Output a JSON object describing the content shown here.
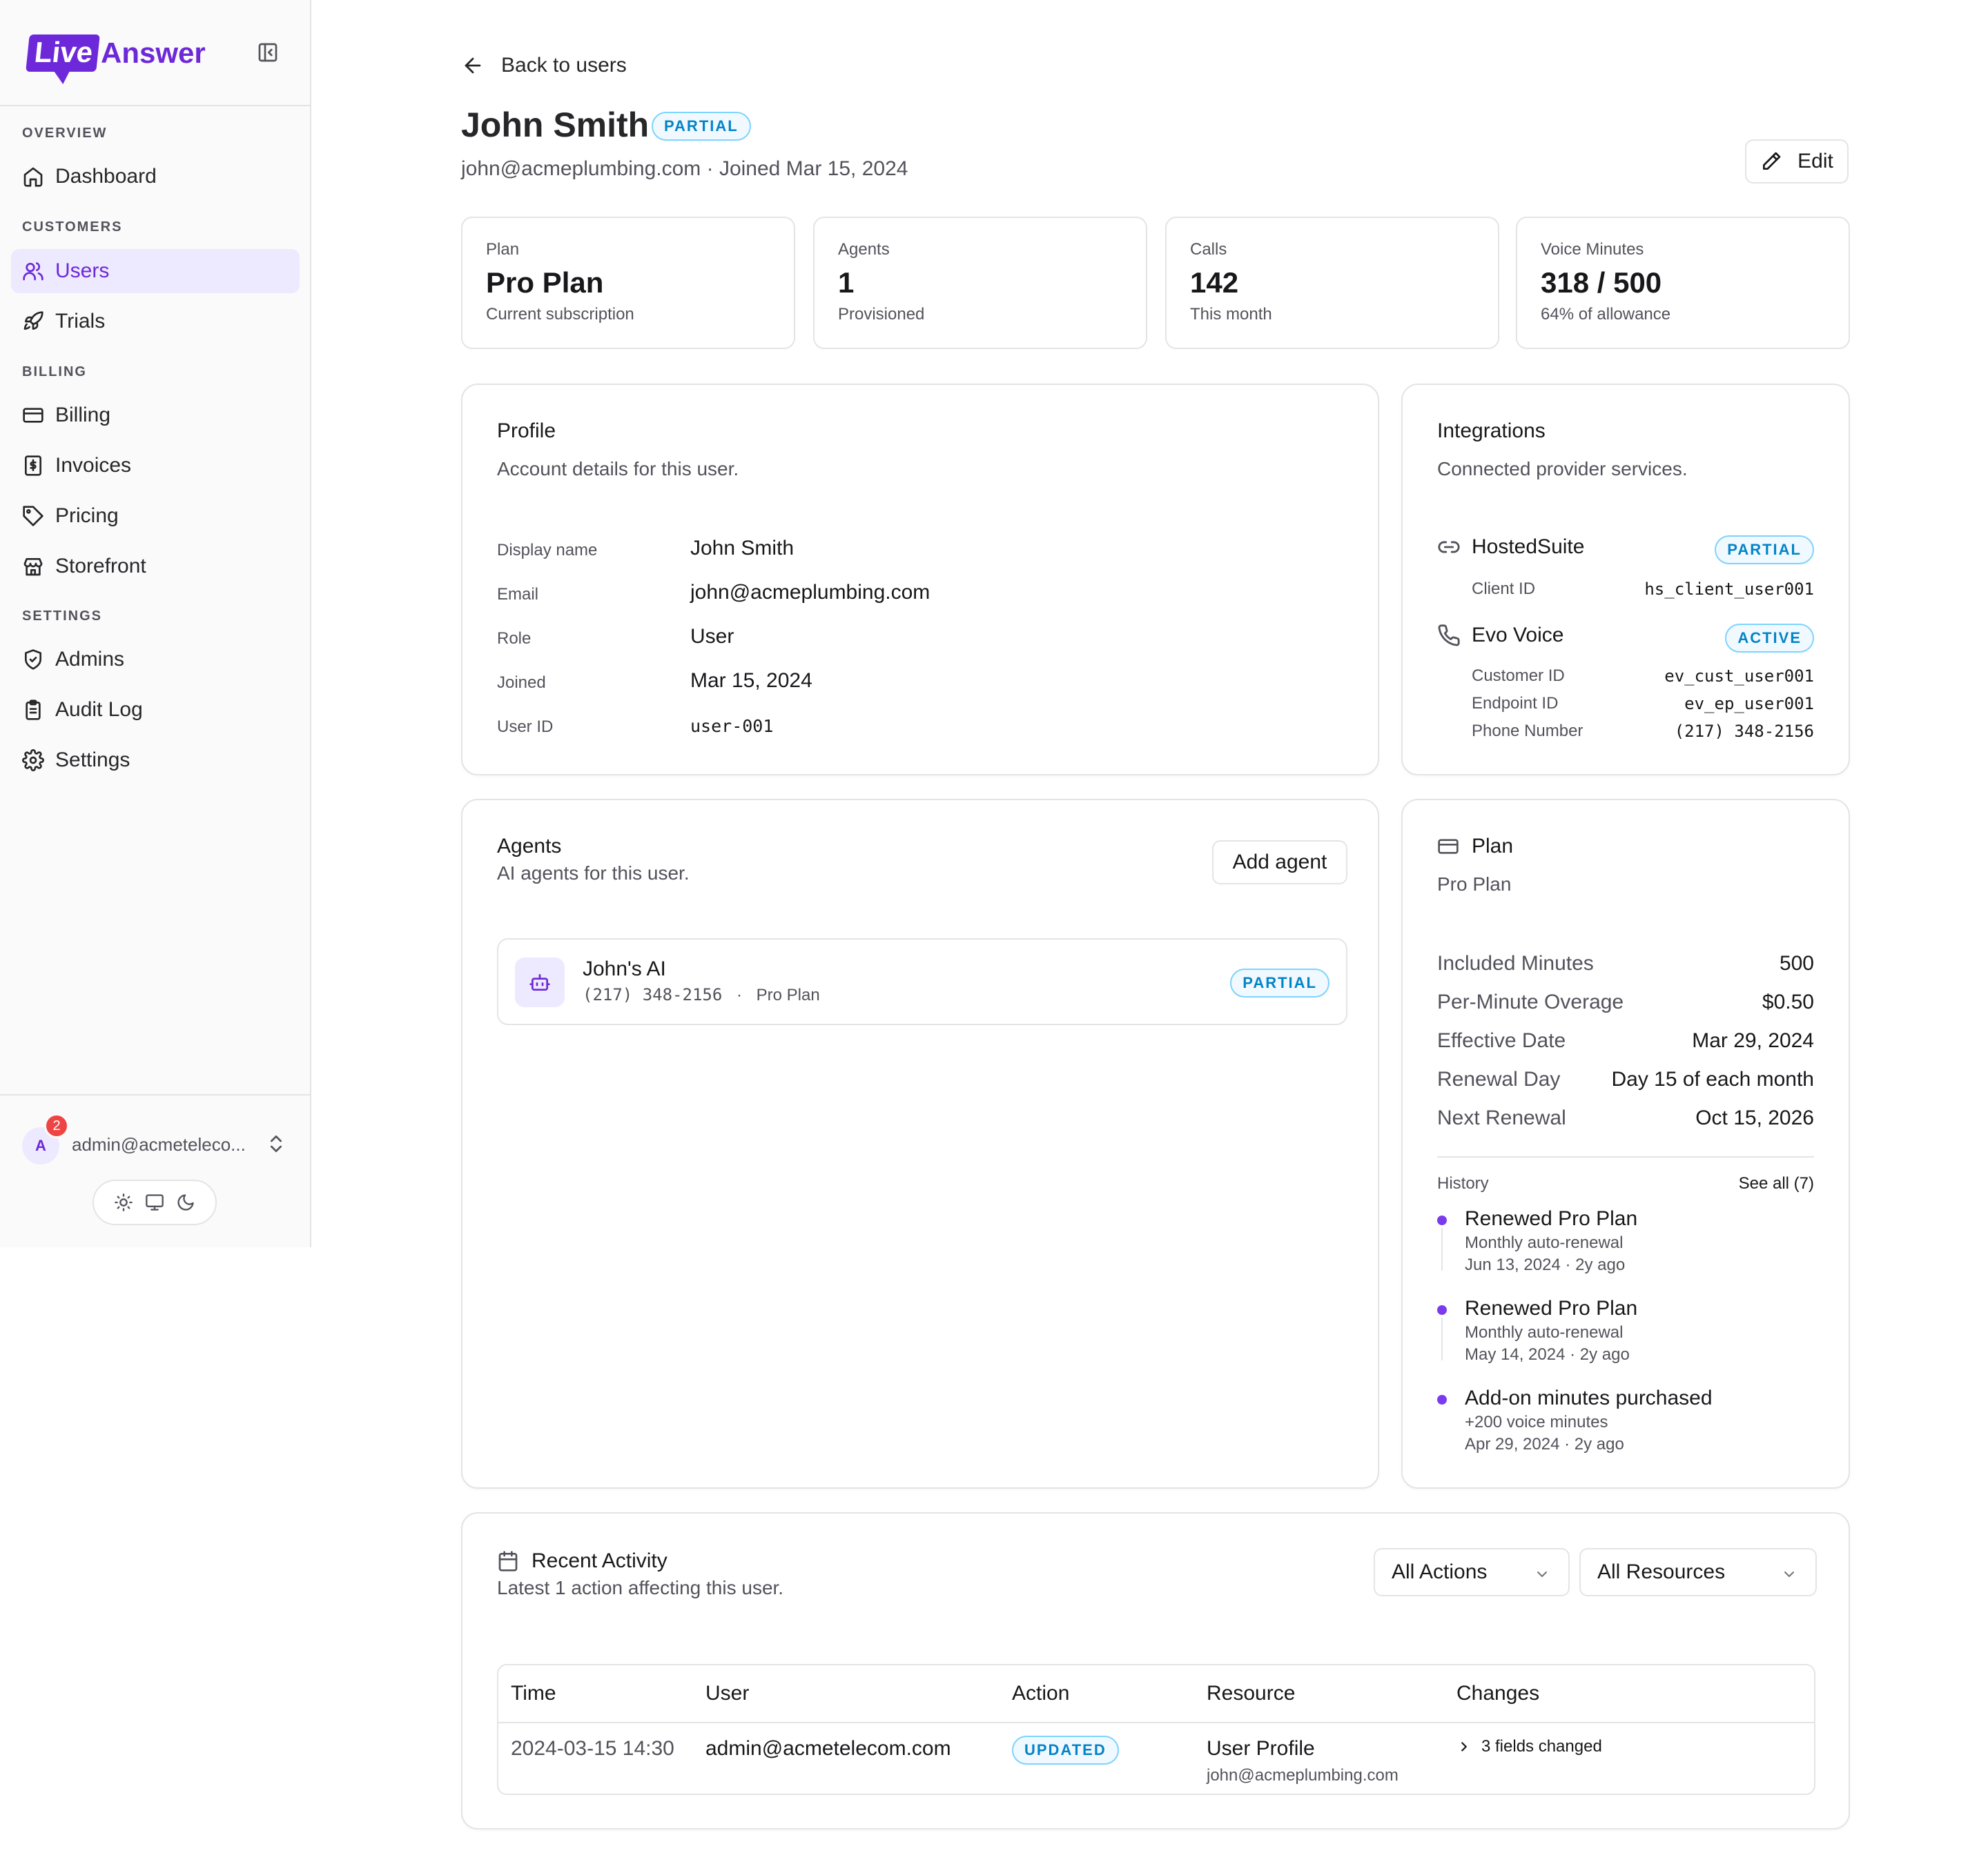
{
  "app": {
    "logo_box": "Live",
    "logo_text": "Answer"
  },
  "sidebar": {
    "sections": [
      {
        "label": "OVERVIEW"
      },
      {
        "label": "CUSTOMERS"
      },
      {
        "label": "BILLING"
      },
      {
        "label": "SETTINGS"
      }
    ],
    "items": [
      {
        "label": "Dashboard",
        "icon": "home-icon"
      },
      {
        "label": "Users",
        "icon": "users-icon",
        "active": true
      },
      {
        "label": "Trials",
        "icon": "rocket-icon"
      },
      {
        "label": "Billing",
        "icon": "credit-card-icon"
      },
      {
        "label": "Invoices",
        "icon": "receipt-icon"
      },
      {
        "label": "Pricing",
        "icon": "tag-icon"
      },
      {
        "label": "Storefront",
        "icon": "store-icon"
      },
      {
        "label": "Admins",
        "icon": "shield-icon"
      },
      {
        "label": "Audit Log",
        "icon": "clipboard-icon"
      },
      {
        "label": "Settings",
        "icon": "gear-icon"
      }
    ],
    "account": {
      "initial": "A",
      "badge": "2",
      "email": "admin@acmeteleco..."
    }
  },
  "header": {
    "back_label": "Back to users",
    "name": "John Smith",
    "status": "PARTIAL",
    "subtitle": "john@acmeplumbing.com · Joined Mar 15, 2024",
    "edit_label": "Edit"
  },
  "stats": [
    {
      "label": "Plan",
      "value": "Pro Plan",
      "sub": "Current subscription"
    },
    {
      "label": "Agents",
      "value": "1",
      "sub": "Provisioned"
    },
    {
      "label": "Calls",
      "value": "142",
      "sub": "This month"
    },
    {
      "label": "Voice Minutes",
      "value": "318 / 500",
      "sub": "64% of allowance"
    }
  ],
  "profile": {
    "title": "Profile",
    "desc": "Account details for this user.",
    "fields": [
      {
        "label": "Display name",
        "value": "John Smith"
      },
      {
        "label": "Email",
        "value": "john@acmeplumbing.com"
      },
      {
        "label": "Role",
        "value": "User"
      },
      {
        "label": "Joined",
        "value": "Mar 15, 2024"
      },
      {
        "label": "User ID",
        "value": "user-001"
      }
    ]
  },
  "integrations": {
    "title": "Integrations",
    "desc": "Connected provider services.",
    "hostedsuite": {
      "name": "HostedSuite",
      "status": "PARTIAL",
      "k1": "Client ID",
      "v1": "hs_client_user001"
    },
    "evo": {
      "name": "Evo Voice",
      "status": "ACTIVE",
      "k1": "Customer ID",
      "v1": "ev_cust_user001",
      "k2": "Endpoint ID",
      "v2": "ev_ep_user001",
      "k3": "Phone Number",
      "v3": "(217) 348-2156"
    }
  },
  "agents": {
    "title": "Agents",
    "desc": "AI agents for this user.",
    "add_label": "Add agent",
    "items": [
      {
        "name": "John's AI",
        "phone": "(217) 348-2156",
        "sep": "·",
        "plan": "Pro Plan",
        "status": "PARTIAL"
      }
    ]
  },
  "plan": {
    "title": "Plan",
    "name": "Pro Plan",
    "rows": [
      {
        "label": "Included Minutes",
        "value": "500"
      },
      {
        "label": "Per-Minute Overage",
        "value": "$0.50"
      },
      {
        "label": "Effective Date",
        "value": "Mar 29, 2024"
      },
      {
        "label": "Renewal Day",
        "value": "Day 15 of each month"
      },
      {
        "label": "Next Renewal",
        "value": "Oct 15, 2026"
      }
    ],
    "history_label": "History",
    "see_all": "See all (7)",
    "history": [
      {
        "title": "Renewed Pro Plan",
        "sub": "Monthly auto-renewal",
        "date": "Jun 13, 2024 · 2y ago"
      },
      {
        "title": "Renewed Pro Plan",
        "sub": "Monthly auto-renewal",
        "date": "May 14, 2024 · 2y ago"
      },
      {
        "title": "Add-on minutes purchased",
        "sub": "+200 voice minutes",
        "date": "Apr 29, 2024 · 2y ago"
      }
    ]
  },
  "activity": {
    "title": "Recent Activity",
    "desc": "Latest 1 action affecting this user.",
    "filter_actions": "All Actions",
    "filter_resources": "All Resources",
    "columns": [
      "Time",
      "User",
      "Action",
      "Resource",
      "Changes"
    ],
    "rows": [
      {
        "time": "2024-03-15 14:30",
        "user": "admin@acmetelecom.com",
        "action": "UPDATED",
        "resource": "User Profile",
        "resource_sub": "john@acmeplumbing.com",
        "changes": "3 fields changed"
      }
    ]
  }
}
